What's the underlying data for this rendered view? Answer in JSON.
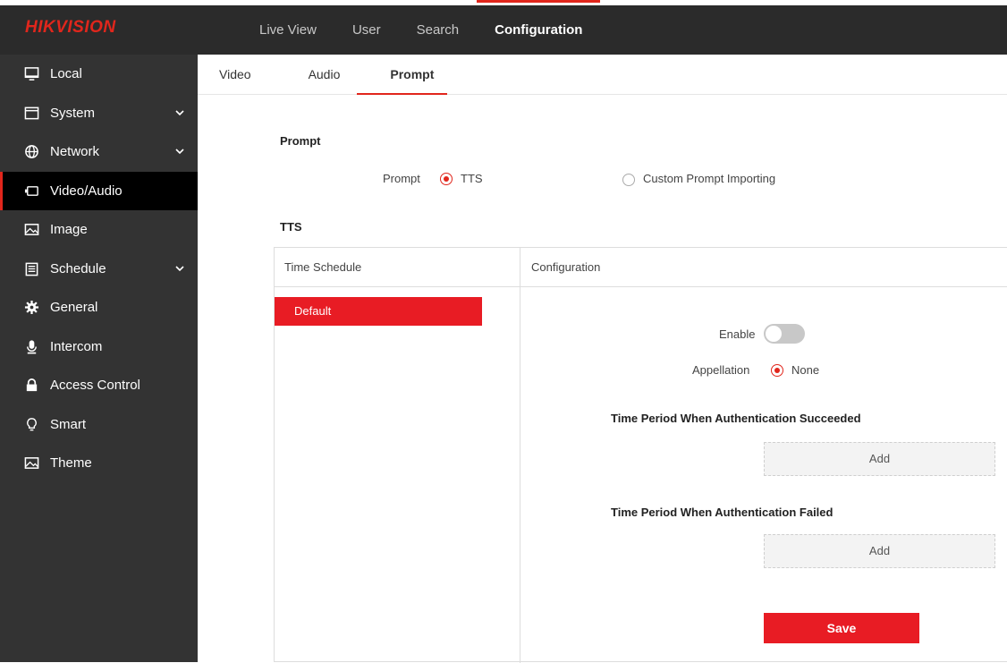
{
  "brand": {
    "hik": "HIK",
    "vision": "VISION"
  },
  "topnav": [
    {
      "label": "Live View"
    },
    {
      "label": "User"
    },
    {
      "label": "Search"
    },
    {
      "label": "Configuration",
      "active": true
    }
  ],
  "sidebar": {
    "items": [
      {
        "label": "Local",
        "icon": "monitor-icon"
      },
      {
        "label": "System",
        "icon": "window-icon",
        "expandable": true
      },
      {
        "label": "Network",
        "icon": "globe-icon",
        "expandable": true
      },
      {
        "label": "Video/Audio",
        "icon": "video-icon",
        "active": true
      },
      {
        "label": "Image",
        "icon": "image-icon"
      },
      {
        "label": "Schedule",
        "icon": "calendar-icon",
        "expandable": true
      },
      {
        "label": "General",
        "icon": "gear-icon"
      },
      {
        "label": "Intercom",
        "icon": "microphone-icon"
      },
      {
        "label": "Access Control",
        "icon": "lock-icon"
      },
      {
        "label": "Smart",
        "icon": "bulb-icon"
      },
      {
        "label": "Theme",
        "icon": "picture-icon"
      }
    ]
  },
  "subtabs": [
    {
      "label": "Video"
    },
    {
      "label": "Audio"
    },
    {
      "label": "Prompt",
      "active": true
    }
  ],
  "prompt": {
    "section_title": "Prompt",
    "field_label": "Prompt",
    "options": [
      {
        "label": "TTS",
        "selected": true
      },
      {
        "label": "Custom Prompt Importing",
        "selected": false
      }
    ]
  },
  "tts": {
    "section_title": "TTS",
    "col_schedule": "Time Schedule",
    "col_config": "Configuration",
    "schedule_item": "Default",
    "enable_label": "Enable",
    "enable_on": false,
    "appellation_label": "Appellation",
    "appellation_option": "None",
    "succeeded_title": "Time Period When Authentication Succeeded",
    "failed_title": "Time Period When Authentication Failed",
    "add_label": "Add",
    "save_label": "Save"
  },
  "colors": {
    "accent": "#e1261c",
    "sidebar": "#333333",
    "topbar": "#2b2b2b"
  }
}
